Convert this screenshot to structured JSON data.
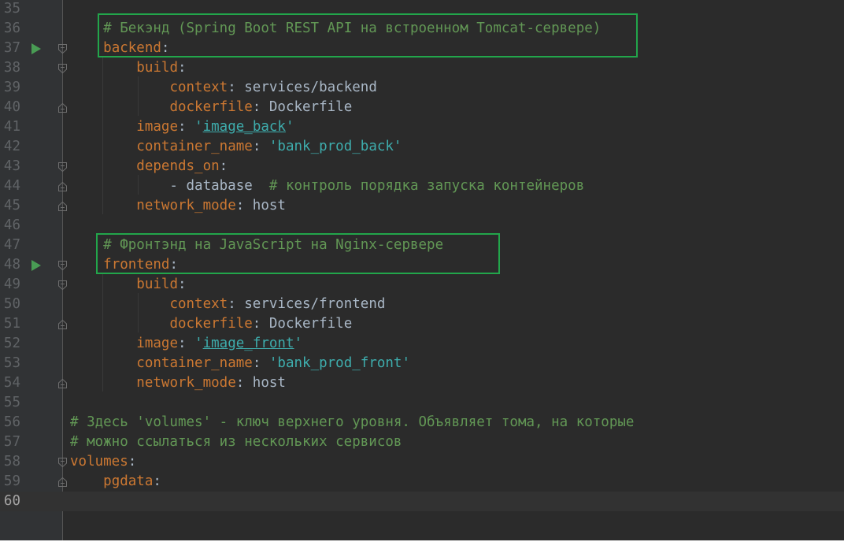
{
  "editor": {
    "lines": [
      {
        "num": "35",
        "tokens": []
      },
      {
        "num": "36",
        "run": false,
        "tokens": [
          {
            "t": "    ",
            "c": "p"
          },
          {
            "t": "# Бекэнд (Spring Boot REST API на встроенном Tomcat-сервере)",
            "c": "c"
          }
        ]
      },
      {
        "num": "37",
        "run": true,
        "fold": "open",
        "tokens": [
          {
            "t": "    ",
            "c": "p"
          },
          {
            "t": "backend",
            "c": "k"
          },
          {
            "t": ":",
            "c": "p"
          }
        ]
      },
      {
        "num": "38",
        "fold": "open",
        "tokens": [
          {
            "t": "        ",
            "c": "p"
          },
          {
            "t": "build",
            "c": "k"
          },
          {
            "t": ":",
            "c": "p"
          }
        ]
      },
      {
        "num": "39",
        "tokens": [
          {
            "t": "            ",
            "c": "p"
          },
          {
            "t": "context",
            "c": "k"
          },
          {
            "t": ": services/backend",
            "c": "p"
          }
        ]
      },
      {
        "num": "40",
        "fold": "end",
        "tokens": [
          {
            "t": "            ",
            "c": "p"
          },
          {
            "t": "dockerfile",
            "c": "k"
          },
          {
            "t": ": Dockerfile",
            "c": "p"
          }
        ]
      },
      {
        "num": "41",
        "tokens": [
          {
            "t": "        ",
            "c": "p"
          },
          {
            "t": "image",
            "c": "k"
          },
          {
            "t": ": ",
            "c": "p"
          },
          {
            "t": "'",
            "c": "t"
          },
          {
            "t": "image_back",
            "c": "su"
          },
          {
            "t": "'",
            "c": "t"
          }
        ]
      },
      {
        "num": "42",
        "tokens": [
          {
            "t": "        ",
            "c": "p"
          },
          {
            "t": "container_name",
            "c": "k"
          },
          {
            "t": ": ",
            "c": "p"
          },
          {
            "t": "'bank_prod_back'",
            "c": "t"
          }
        ]
      },
      {
        "num": "43",
        "fold": "open",
        "tokens": [
          {
            "t": "        ",
            "c": "p"
          },
          {
            "t": "depends_on",
            "c": "k"
          },
          {
            "t": ":",
            "c": "p"
          }
        ]
      },
      {
        "num": "44",
        "fold": "end",
        "tokens": [
          {
            "t": "            - database  ",
            "c": "p"
          },
          {
            "t": "# контроль порядка запуска контейнеров",
            "c": "c"
          }
        ]
      },
      {
        "num": "45",
        "fold": "end",
        "tokens": [
          {
            "t": "        ",
            "c": "p"
          },
          {
            "t": "network_mode",
            "c": "k"
          },
          {
            "t": ": host",
            "c": "p"
          }
        ]
      },
      {
        "num": "46",
        "tokens": []
      },
      {
        "num": "47",
        "tokens": [
          {
            "t": "    ",
            "c": "p"
          },
          {
            "t": "# Фронтэнд на JavaScript на Nginx-сервере",
            "c": "c"
          }
        ]
      },
      {
        "num": "48",
        "run": true,
        "fold": "open",
        "tokens": [
          {
            "t": "    ",
            "c": "p"
          },
          {
            "t": "frontend",
            "c": "k"
          },
          {
            "t": ":",
            "c": "p"
          }
        ]
      },
      {
        "num": "49",
        "fold": "open",
        "tokens": [
          {
            "t": "        ",
            "c": "p"
          },
          {
            "t": "build",
            "c": "k"
          },
          {
            "t": ":",
            "c": "p"
          }
        ]
      },
      {
        "num": "50",
        "tokens": [
          {
            "t": "            ",
            "c": "p"
          },
          {
            "t": "context",
            "c": "k"
          },
          {
            "t": ": services/frontend",
            "c": "p"
          }
        ]
      },
      {
        "num": "51",
        "fold": "end",
        "tokens": [
          {
            "t": "            ",
            "c": "p"
          },
          {
            "t": "dockerfile",
            "c": "k"
          },
          {
            "t": ": Dockerfile",
            "c": "p"
          }
        ]
      },
      {
        "num": "52",
        "tokens": [
          {
            "t": "        ",
            "c": "p"
          },
          {
            "t": "image",
            "c": "k"
          },
          {
            "t": ": ",
            "c": "p"
          },
          {
            "t": "'",
            "c": "t"
          },
          {
            "t": "image_front",
            "c": "su"
          },
          {
            "t": "'",
            "c": "t"
          }
        ]
      },
      {
        "num": "53",
        "tokens": [
          {
            "t": "        ",
            "c": "p"
          },
          {
            "t": "container_name",
            "c": "k"
          },
          {
            "t": ": ",
            "c": "p"
          },
          {
            "t": "'bank_prod_front'",
            "c": "t"
          }
        ]
      },
      {
        "num": "54",
        "fold": "end",
        "tokens": [
          {
            "t": "        ",
            "c": "p"
          },
          {
            "t": "network_mode",
            "c": "k"
          },
          {
            "t": ": host",
            "c": "p"
          }
        ]
      },
      {
        "num": "55",
        "tokens": []
      },
      {
        "num": "56",
        "tokens": [
          {
            "t": "# Здесь 'volumes' - ключ верхнего уровня. Объявляет тома, на которые",
            "c": "c"
          }
        ]
      },
      {
        "num": "57",
        "tokens": [
          {
            "t": "# можно ссылаться из нескольких сервисов",
            "c": "c"
          }
        ]
      },
      {
        "num": "58",
        "fold": "open",
        "tokens": [
          {
            "t": "volumes",
            "c": "k"
          },
          {
            "t": ":",
            "c": "p"
          }
        ]
      },
      {
        "num": "59",
        "fold": "end",
        "tokens": [
          {
            "t": "    ",
            "c": "p"
          },
          {
            "t": "pgdata",
            "c": "k"
          },
          {
            "t": ":",
            "c": "p"
          }
        ]
      },
      {
        "num": "60",
        "current": true,
        "tokens": []
      }
    ]
  },
  "colors": {
    "background": "#2b2b2b",
    "gutter": "#313335",
    "key": "#cc7832",
    "comment": "#629755",
    "string": "#3eadad",
    "plain": "#a9b7c6",
    "highlight_box": "#22a64b",
    "run_icon": "#499c54"
  }
}
